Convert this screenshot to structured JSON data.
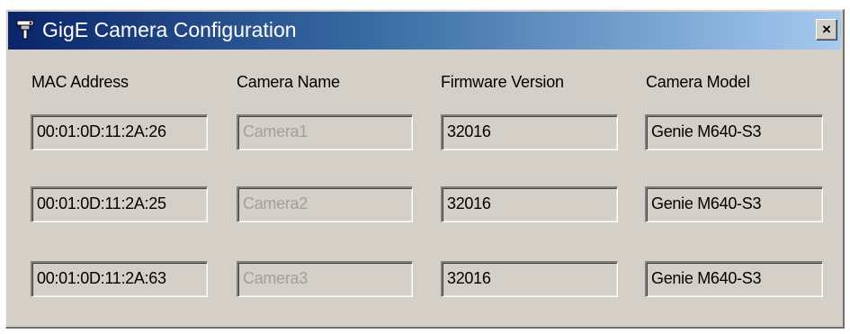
{
  "window": {
    "title": "GigE Camera Configuration",
    "close_label": "×"
  },
  "columns": {
    "mac": "MAC Address",
    "name": "Camera Name",
    "firmware": "Firmware Version",
    "model": "Camera Model"
  },
  "rows": [
    {
      "mac": "00:01:0D:11:2A:26",
      "name": "Camera1",
      "firmware": "32016",
      "model": "Genie M640-S3"
    },
    {
      "mac": "00:01:0D:11:2A:25",
      "name": "Camera2",
      "firmware": "32016",
      "model": "Genie M640-S3"
    },
    {
      "mac": "00:01:0D:11:2A:63",
      "name": "Camera3",
      "firmware": "32016",
      "model": "Genie M640-S3"
    }
  ],
  "colors": {
    "titlebar_start": "#0a246a",
    "titlebar_end": "#a6caf0",
    "face": "#d4d0c8",
    "disabled_text": "#a0a0a0"
  },
  "icons": {
    "title": "camera-network-icon",
    "close": "close-icon"
  }
}
